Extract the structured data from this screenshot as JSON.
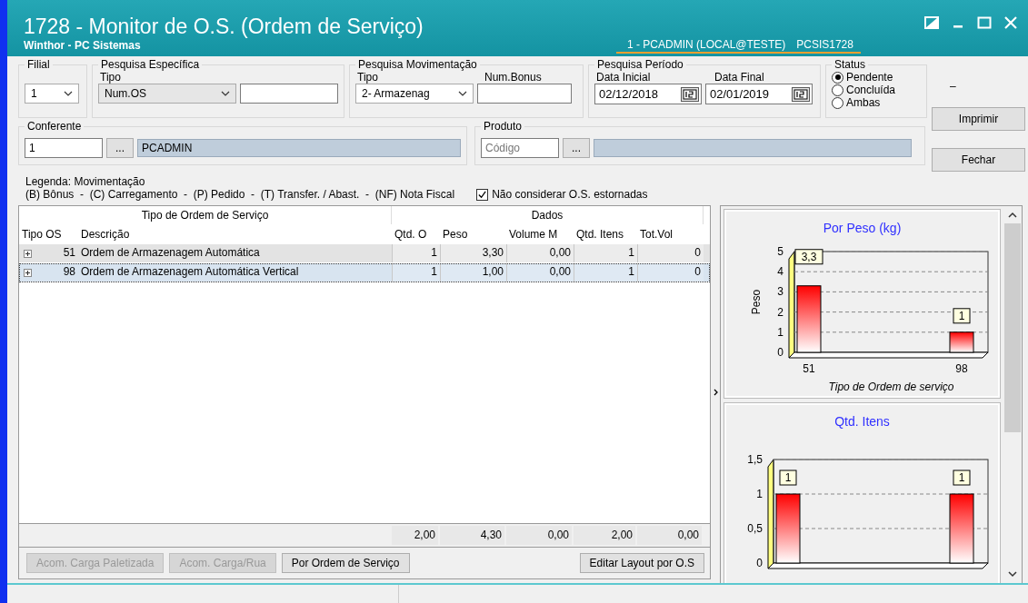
{
  "window": {
    "title": "1728 - Monitor de O.S. (Ordem de Serviço)",
    "subtitle": "Winthor - PC Sistemas",
    "session": "1 - PCADMIN (LOCAL@TESTE)",
    "program": "PCSIS1728"
  },
  "filters": {
    "filial": {
      "label": "Filial",
      "value": "1"
    },
    "pesquisa_especifica": {
      "label": "Pesquisa Específica",
      "tipo_label": "Tipo",
      "tipo_value": "Num.OS"
    },
    "pesquisa_movimentacao": {
      "label": "Pesquisa Movimentação",
      "tipo_label": "Tipo",
      "tipo_value": "2- Armazenag",
      "bonus_label": "Num.Bonus"
    },
    "pesquisa_periodo": {
      "label": "Pesquisa Período",
      "inicial_label": "Data Inicial",
      "inicial_value": "02/12/2018",
      "final_label": "Data Final",
      "final_value": "02/01/2019"
    },
    "status": {
      "label": "Status",
      "options": [
        {
          "label": "Pendente",
          "selected": true
        },
        {
          "label": "Concluída",
          "selected": false
        },
        {
          "label": "Ambas",
          "selected": false
        }
      ]
    },
    "conferente": {
      "label": "Conferente",
      "code": "1",
      "browse": "...",
      "name": "PCADMIN"
    },
    "produto": {
      "label": "Produto",
      "placeholder": "Código",
      "browse": "..."
    }
  },
  "side": {
    "dash": "–",
    "buttons": [
      "Imprimir",
      "Fechar"
    ]
  },
  "legend": {
    "title": "Legenda: Movimentação",
    "text": "(B) Bônus  -  (C) Carregamento  -  (P) Pedido  -  (T) Transfer. / Abast.  -  (NF) Nota Fiscal",
    "checkbox": {
      "label": "Não considerar O.S. estornadas",
      "checked": true
    }
  },
  "table": {
    "group_headers": [
      "Tipo de Ordem de Serviço",
      "Dados"
    ],
    "columns": [
      "Tipo OS",
      "Descrição",
      "Qtd. O",
      "Peso",
      "Volume M",
      "Qtd. Itens",
      "Tot.Vol"
    ],
    "rows": [
      {
        "cells": [
          "51",
          "Ordem de Armazenagem Automática",
          "1",
          "3,30",
          "0,00",
          "1",
          "0"
        ],
        "selected": false
      },
      {
        "cells": [
          "98",
          "Ordem de Armazenagem Automática Vertical",
          "1",
          "1,00",
          "0,00",
          "1",
          "0"
        ],
        "selected": true
      }
    ],
    "totals": [
      "2,00",
      "4,30",
      "0,00",
      "2,00",
      "0,00"
    ]
  },
  "bottom_buttons": [
    {
      "label": "Acom. Carga Paletizada",
      "disabled": true
    },
    {
      "label": "Acom. Carga/Rua",
      "disabled": true
    },
    {
      "label": "Por Ordem de Serviço",
      "disabled": false
    },
    {
      "label": "Editar Layout por O.S",
      "disabled": false
    }
  ],
  "charts": [
    {
      "chart_data": {
        "type": "bar",
        "title": "Por Peso (kg)",
        "xlabel": "Tipo de Ordem de serviço",
        "ylabel": "Peso",
        "categories": [
          "51",
          "98"
        ],
        "values": [
          3.3,
          1
        ],
        "ylim": [
          0,
          5
        ],
        "yticks": [
          0,
          1,
          2,
          3,
          4,
          5
        ],
        "grid": true,
        "value_labels": [
          "3,3",
          "1"
        ]
      }
    },
    {
      "chart_data": {
        "type": "bar",
        "title": "Qtd. Itens",
        "values": [
          1,
          1
        ],
        "ylim": [
          0,
          1.5
        ],
        "yticks": [
          {
            "value": 0,
            "label": "0"
          },
          {
            "value": 0.5,
            "label": "0,5"
          },
          {
            "value": 1,
            "label": "1"
          },
          {
            "value": 1.5,
            "label": "1,5"
          }
        ],
        "grid": true,
        "value_labels": [
          "1",
          "1"
        ]
      }
    }
  ]
}
